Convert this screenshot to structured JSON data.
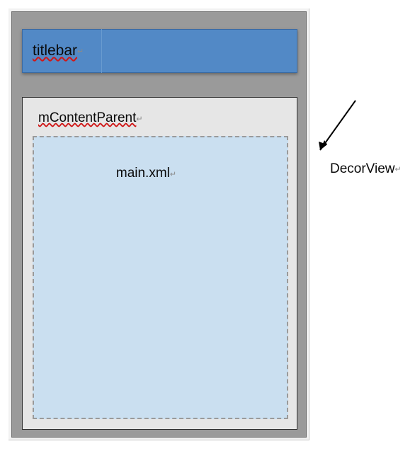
{
  "diagram": {
    "titlebar_label": "titlebar",
    "content_parent_label": "mContentParent",
    "main_xml_label": "main.xml",
    "decor_view_label": "DecorView",
    "enter_mark": "↵"
  }
}
